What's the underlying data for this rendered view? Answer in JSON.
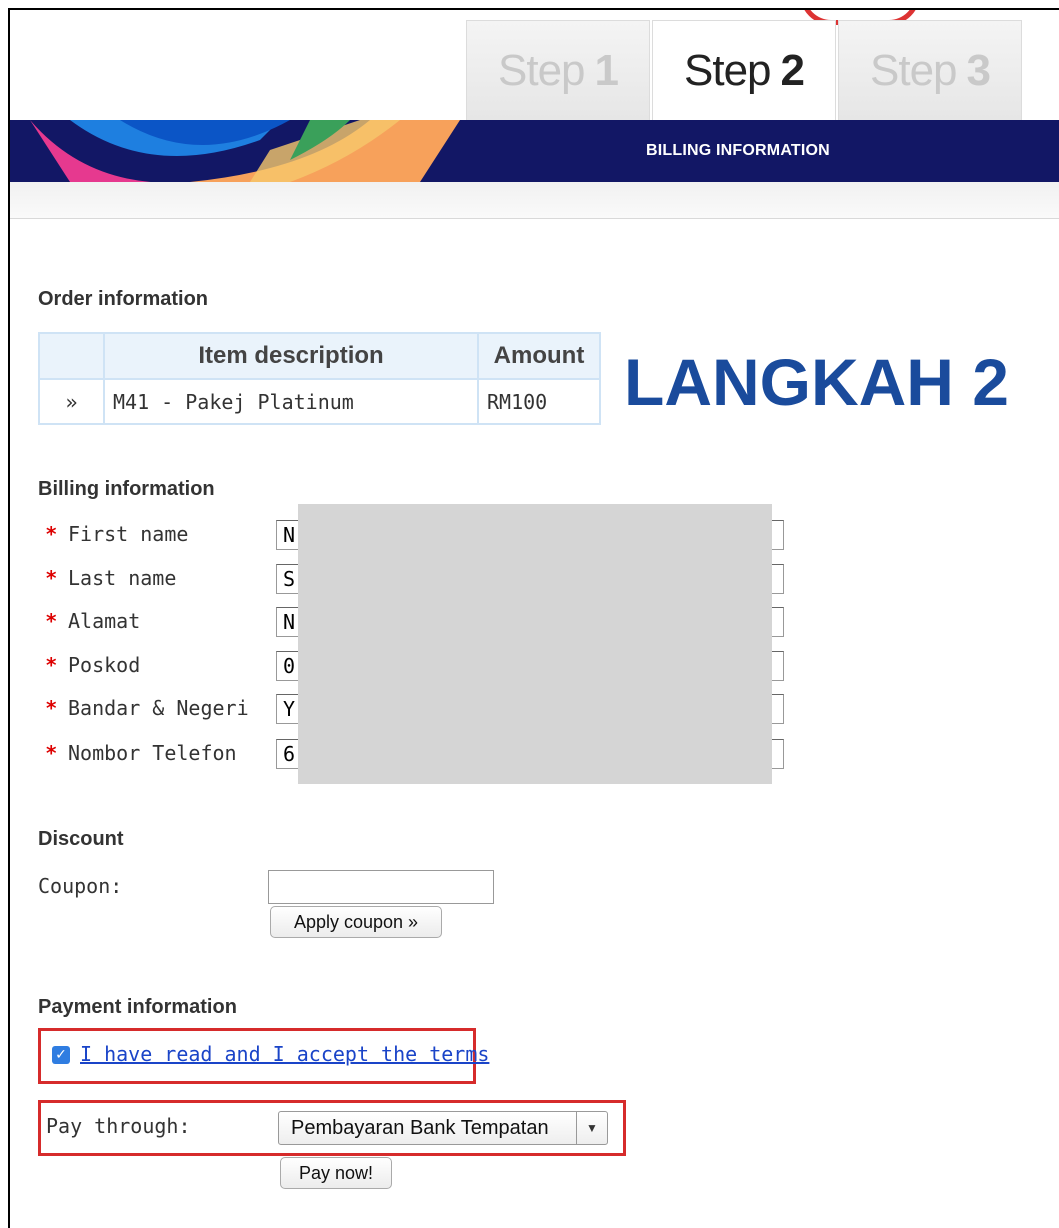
{
  "tabs": [
    {
      "label": "Step",
      "num": "1"
    },
    {
      "label": "Step",
      "num": "2"
    },
    {
      "label": "Step",
      "num": "3"
    }
  ],
  "banner": {
    "title": "BILLING INFORMATION"
  },
  "order": {
    "heading": "Order information",
    "headers": [
      "",
      "Item description",
      "Amount"
    ],
    "rows": [
      {
        "marker": "»",
        "description": "M41 - Pakej Platinum",
        "amount": "RM100"
      }
    ]
  },
  "annotation": "LANGKAH 2",
  "billing": {
    "heading": "Billing information",
    "required_marker": "*",
    "fields": [
      {
        "label": "First name",
        "value": "N"
      },
      {
        "label": "Last name",
        "value": "S"
      },
      {
        "label": "Alamat",
        "value": "N"
      },
      {
        "label": "Poskod",
        "value": "0"
      },
      {
        "label": "Bandar & Negeri",
        "value": "Y"
      },
      {
        "label": "Nombor Telefon",
        "value": "6"
      }
    ]
  },
  "discount": {
    "heading": "Discount",
    "coupon_label": "Coupon:",
    "coupon_value": "",
    "apply_label": "Apply coupon »"
  },
  "payment": {
    "heading": "Payment information",
    "terms_label": "I have read and I accept the terms",
    "terms_checked": true,
    "pay_through_label": "Pay through:",
    "pay_method": "Pembayaran Bank Tempatan",
    "pay_now_label": "Pay now!"
  },
  "colors": {
    "banner_bg": "#121765",
    "annotation": "#1a4b9c",
    "highlight": "#d62b2b",
    "link": "#1a44c8"
  }
}
